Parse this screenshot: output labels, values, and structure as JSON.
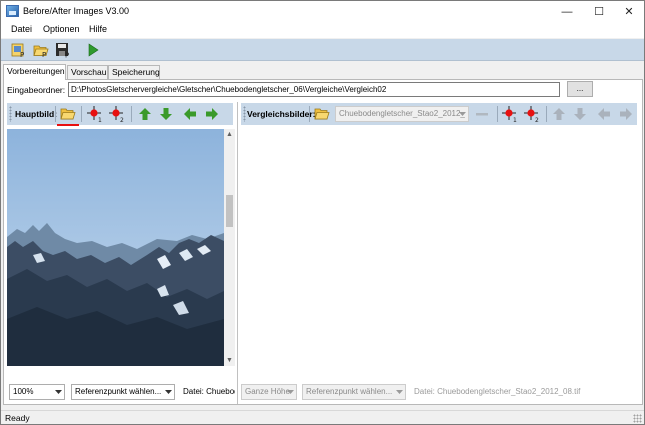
{
  "window": {
    "title": "Before/After Images V3.00",
    "minimize_glyph": "—",
    "maximize_glyph": "☐",
    "close_glyph": "✕"
  },
  "menu": [
    {
      "label": "Datei"
    },
    {
      "label": "Optionen"
    },
    {
      "label": "Hilfe"
    }
  ],
  "toolbar": {
    "icons": [
      "new-project-icon",
      "open-project-icon",
      "save-project-icon",
      "run-icon"
    ]
  },
  "tabs": [
    {
      "label": "Vorbereitungen",
      "active": true
    },
    {
      "label": "Vorschau",
      "active": false
    },
    {
      "label": "Speicherung",
      "active": false
    }
  ],
  "input_folder": {
    "label": "Eingabeordner:",
    "value": "D:\\PhotosGletschervergleiche\\Gletscher\\Chuebodengletscher_06\\Vergleiche\\Vergleich02",
    "browse_label": "..."
  },
  "main_image_panel": {
    "label": "Hauptbild:",
    "zoom_value": "100%",
    "ref_point_value": "Referenzpunkt wählen...",
    "file_label": "Datei: Chuebod"
  },
  "compare_panel": {
    "label": "Vergleichsbilder:",
    "image_select_value": "Chuebodengletscher_Stao2_2012_",
    "zoom_value": "Ganze Höhe",
    "ref_point_value": "Referenzpunkt wählen...",
    "file_label": "Datei: Chuebodengletscher_Stao2_2012_08.tif"
  },
  "status": {
    "text": "Ready"
  },
  "colors": {
    "toolbar_bg": "#c8d8e8",
    "marker_red": "#e81010",
    "arrow_green": "#3a9a2a"
  }
}
